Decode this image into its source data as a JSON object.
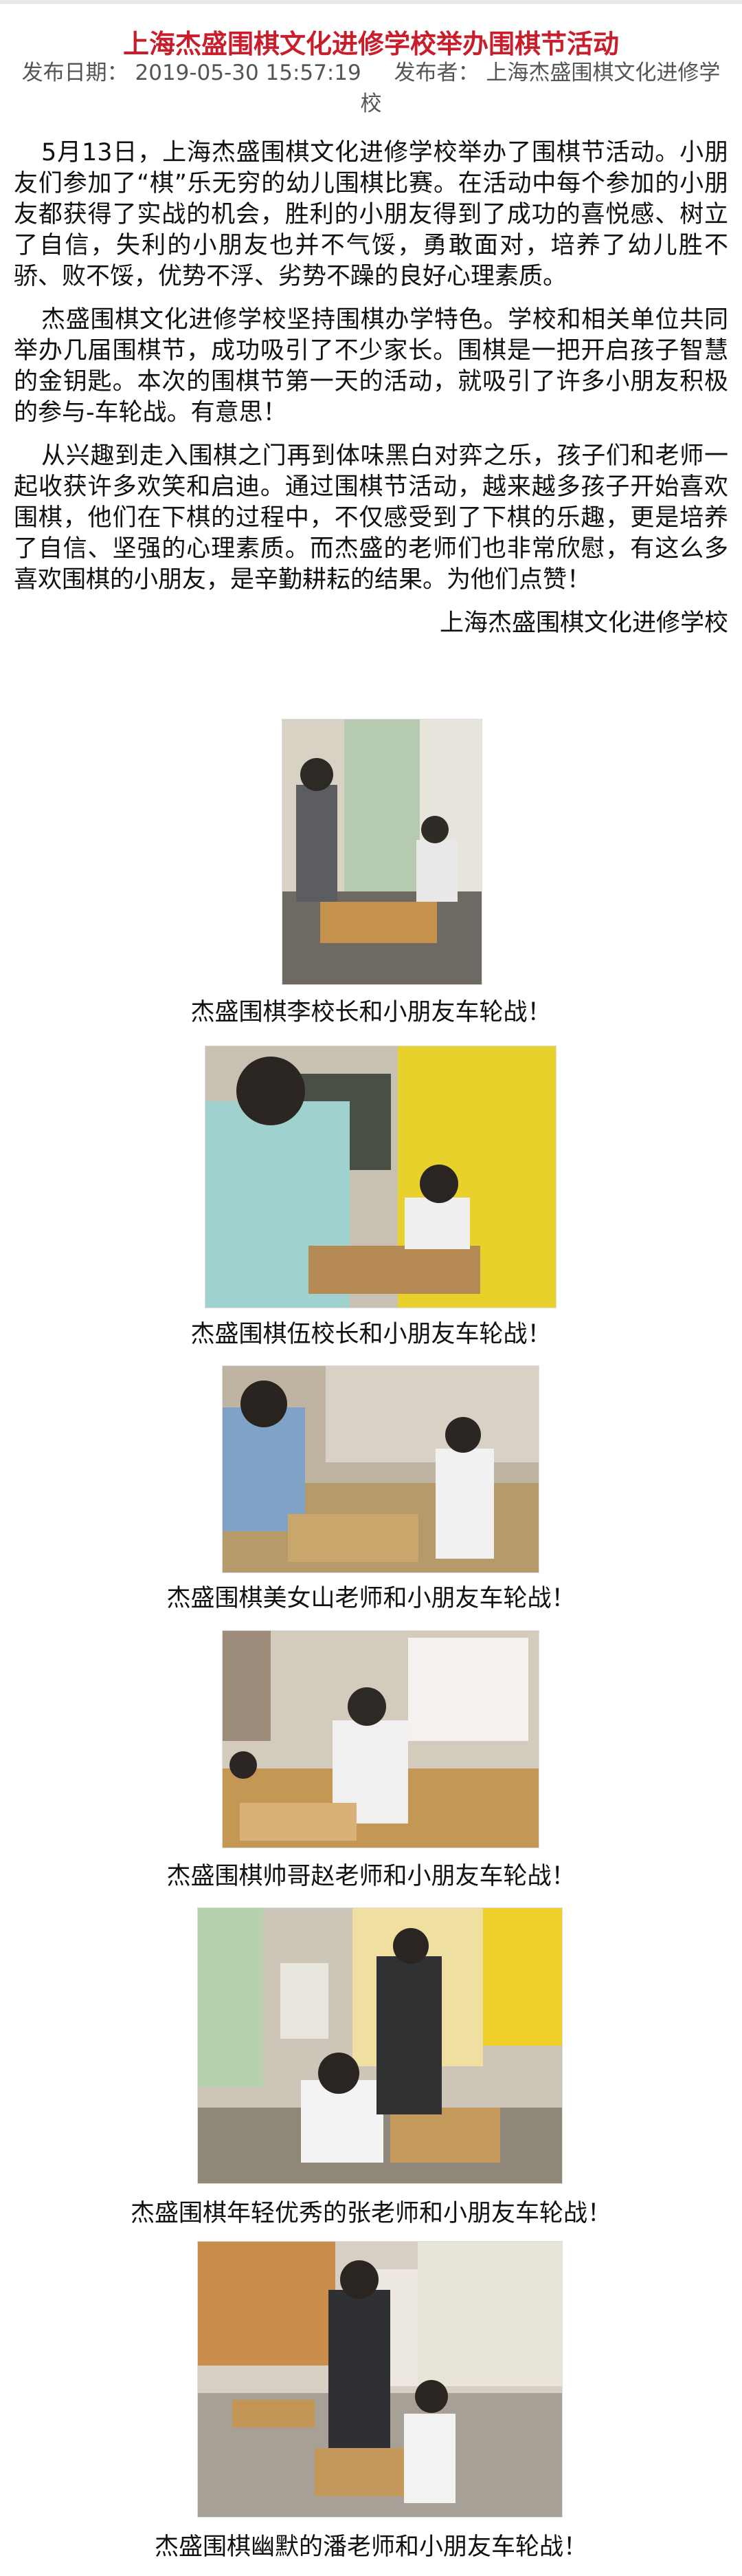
{
  "article": {
    "title": "上海杰盛围棋文化进修学校举办围棋节活动",
    "meta": {
      "date_label": "发布日期：",
      "date_value": "2019-05-30 15:57:19",
      "author_label": "发布者：",
      "author_value": "上海杰盛围棋文化进修学校"
    },
    "paragraphs": [
      "5月13日，上海杰盛围棋文化进修学校举办了围棋节活动。小朋友们参加了“棋”乐无穷的幼儿围棋比赛。在活动中每个参加的小朋友都获得了实战的机会，胜利的小朋友得到了成功的喜悦感、树立了自信，失利的小朋友也并不气馁，勇敢面对，培养了幼儿胜不骄、败不馁，优势不浮、劣势不躁的良好心理素质。",
      "杰盛围棋文化进修学校坚持围棋办学特色。学校和相关单位共同举办几届围棋节，成功吸引了不少家长。围棋是一把开启孩子智慧的金钥匙。本次的围棋节第一天的活动，就吸引了许多小朋友积极的参与-车轮战。有意思！",
      "从兴趣到走入围棋之门再到体味黑白对弈之乐，孩子们和老师一起收获许多欢笑和启迪。通过围棋节活动，越来越多孩子开始喜欢围棋，他们在下棋的过程中，不仅感受到了下棋的乐趣，更是培养了自信、坚强的心理素质。而杰盛的老师们也非常欣慰，有这么多喜欢围棋的小朋友，是辛勤耕耘的结果。为他们点赞！"
    ],
    "signature": "上海杰盛围棋文化进修学校"
  },
  "figures": [
    {
      "caption": "杰盛围棋李校长和小朋友车轮战！"
    },
    {
      "caption": "杰盛围棋伍校长和小朋友车轮战！"
    },
    {
      "caption": "杰盛围棋美女山老师和小朋友车轮战！"
    },
    {
      "caption": "杰盛围棋帅哥赵老师和小朋友车轮战！"
    },
    {
      "caption": "杰盛围棋年轻优秀的张老师和小朋友车轮战！"
    },
    {
      "caption": "杰盛围棋幽默的潘老师和小朋友车轮战！"
    }
  ],
  "colors": {
    "title": "#c81e2c",
    "meta": "#555555",
    "text": "#111111"
  }
}
